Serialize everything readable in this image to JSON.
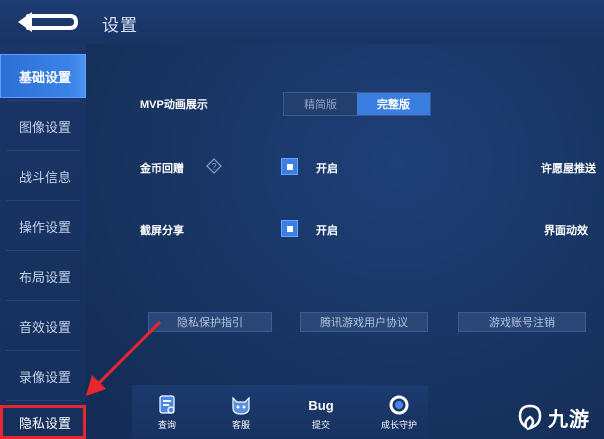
{
  "header": {
    "title": "设置"
  },
  "sidebar": {
    "items": [
      {
        "label": "基础设置",
        "active": true
      },
      {
        "label": "图像设置"
      },
      {
        "label": "战斗信息"
      },
      {
        "label": "操作设置"
      },
      {
        "label": "布局设置"
      },
      {
        "label": "音效设置"
      },
      {
        "label": "录像设置"
      },
      {
        "label": "隐私设置",
        "highlighted": true
      }
    ]
  },
  "settings": {
    "mvp": {
      "label": "MVP动画展示",
      "options": [
        "精简版",
        "完整版"
      ],
      "selected": "完整版"
    },
    "gold_playback": {
      "label": "金币回赠",
      "checkbox_label": "开启",
      "checked": true
    },
    "screenshot_share": {
      "label": "截屏分享",
      "checkbox_label": "开启",
      "checked": true
    },
    "right_label_1": "许愿屋推送",
    "right_label_2": "界面动效"
  },
  "links": {
    "privacy": "隐私保护指引",
    "tencent_agreement": "腾讯游戏用户协议",
    "account_cancel": "游戏账号注销"
  },
  "bottom_nav": [
    {
      "label": "查询",
      "icon": "query-icon"
    },
    {
      "label": "客服",
      "icon": "customer-service-icon"
    },
    {
      "label": "提交",
      "icon": "bug-icon",
      "icon_text": "Bug"
    },
    {
      "label": "成长守护",
      "icon": "growth-guard-icon"
    }
  ],
  "colors": {
    "accent": "#3a7fe0",
    "highlight": "#e8262d",
    "background": "#17335f"
  },
  "watermark": {
    "text": "九游"
  }
}
